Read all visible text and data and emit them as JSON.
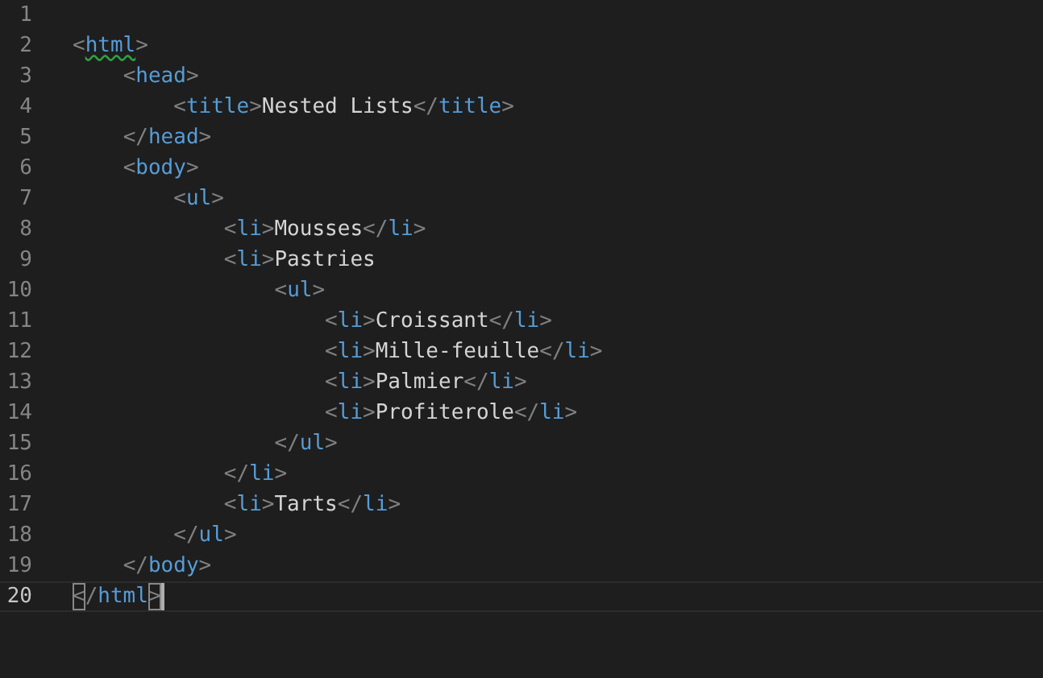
{
  "editor": {
    "lines": [
      {
        "number": "1",
        "current": false
      },
      {
        "number": "2",
        "code": "<html>",
        "current": false,
        "warning": true,
        "bracket_match": false
      },
      {
        "number": "3",
        "code": "    <head>",
        "current": false,
        "warning": false,
        "bracket_match": false
      },
      {
        "number": "4",
        "code": "        <title>Nested Lists</title>",
        "current": false,
        "warning": false,
        "bracket_match": false
      },
      {
        "number": "5",
        "code": "    </head>",
        "current": false,
        "warning": false,
        "bracket_match": false
      },
      {
        "number": "6",
        "code": "    <body>",
        "current": false,
        "warning": false,
        "bracket_match": false
      },
      {
        "number": "7",
        "code": "        <ul>",
        "current": false,
        "warning": false,
        "bracket_match": false
      },
      {
        "number": "8",
        "code": "            <li>Mousses</li>",
        "current": false,
        "warning": false,
        "bracket_match": false
      },
      {
        "number": "9",
        "code": "            <li>Pastries",
        "current": false,
        "warning": false,
        "bracket_match": false
      },
      {
        "number": "10",
        "code": "                <ul>",
        "current": false,
        "warning": false,
        "bracket_match": false
      },
      {
        "number": "11",
        "code": "                    <li>Croissant</li>",
        "current": false,
        "warning": false,
        "bracket_match": false
      },
      {
        "number": "12",
        "code": "                    <li>Mille-feuille</li>",
        "current": false,
        "warning": false,
        "bracket_match": false
      },
      {
        "number": "13",
        "code": "                    <li>Palmier</li>",
        "current": false,
        "warning": false,
        "bracket_match": false
      },
      {
        "number": "14",
        "code": "                    <li>Profiterole</li>",
        "current": false,
        "warning": false,
        "bracket_match": false
      },
      {
        "number": "15",
        "code": "                </ul>",
        "current": false,
        "warning": false,
        "bracket_match": false
      },
      {
        "number": "16",
        "code": "            </li>",
        "current": false,
        "warning": false,
        "bracket_match": false
      },
      {
        "number": "17",
        "code": "            <li>Tarts</li>",
        "current": false,
        "warning": false,
        "bracket_match": false
      },
      {
        "number": "18",
        "code": "        </ul>",
        "current": false,
        "warning": false,
        "bracket_match": false
      },
      {
        "number": "19",
        "code": "    </body>",
        "current": false,
        "warning": false,
        "bracket_match": false
      },
      {
        "number": "20",
        "code": "</html>",
        "current": true,
        "warning": false,
        "bracket_match": true
      }
    ]
  }
}
